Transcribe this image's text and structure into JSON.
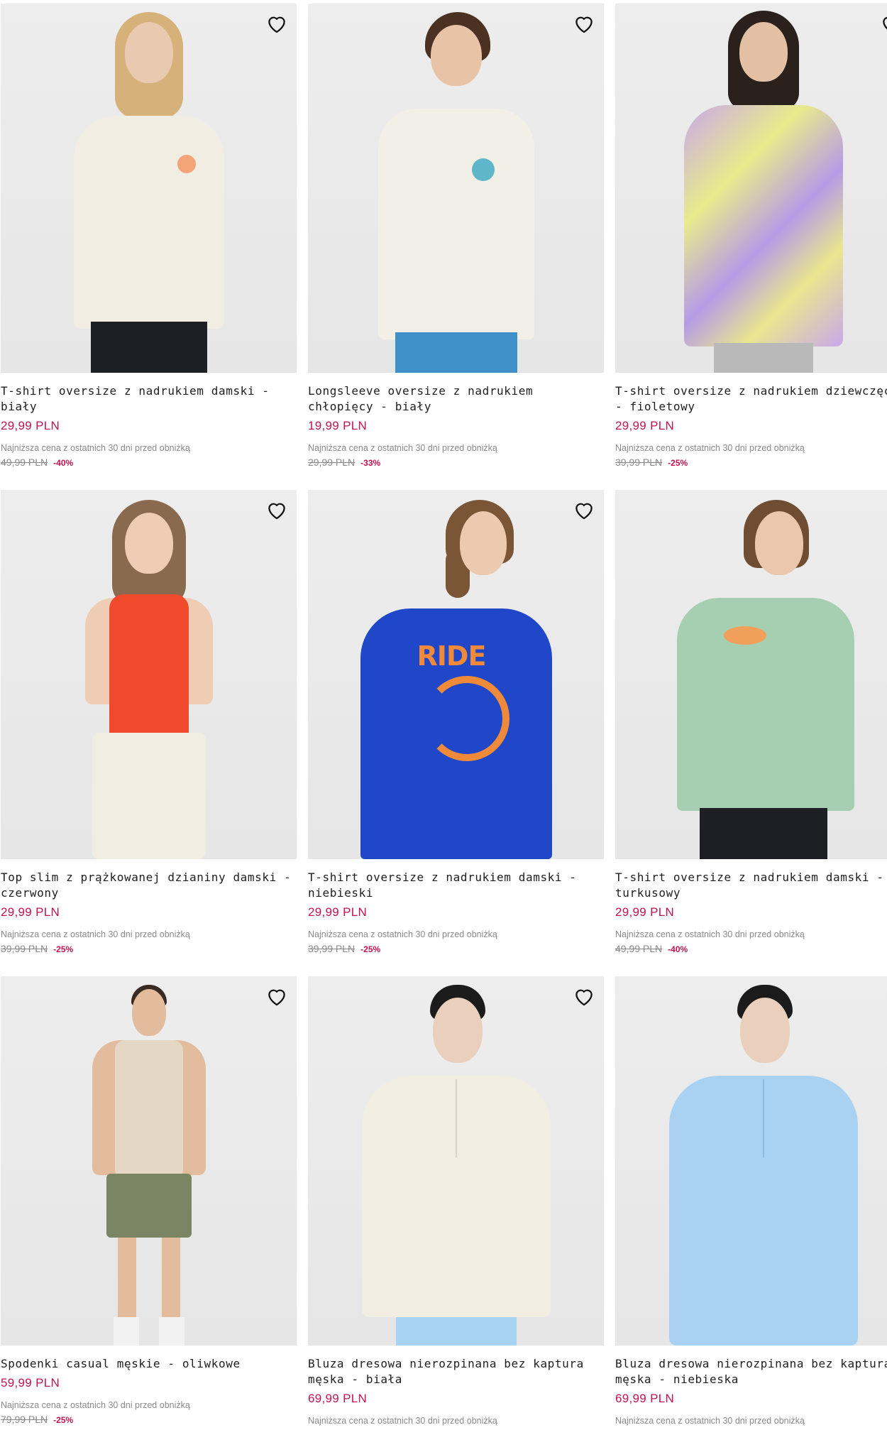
{
  "favorite_icon": "heart-outline-icon",
  "price_color": "#c4124f",
  "products": [
    {
      "name": "T-shirt oversize z nadrukiem damski - biały",
      "price": "29,99 PLN",
      "lowest_label": "Najniższa cena z ostatnich 30 dni przed obniżką",
      "old_price": "49,99 PLN",
      "discount": "-40%",
      "garment_color": "#f1ede3",
      "bottom_color": "#1d1f24",
      "skin": "#e9c9b0",
      "hair": "#d6b27a"
    },
    {
      "name": "Longsleeve oversize z nadrukiem chłopięcy - biały",
      "price": "19,99 PLN",
      "lowest_label": "Najniższa cena z ostatnich 30 dni przed obniżką",
      "old_price": "29,99 PLN",
      "discount": "-33%",
      "garment_color": "#f2efe6",
      "bottom_color": "#3f8fc9",
      "skin": "#e8c3a6",
      "hair": "#4a3122"
    },
    {
      "name": "T-shirt oversize z nadrukiem dziewczęcy - fioletowy",
      "price": "29,99 PLN",
      "lowest_label": "Najniższa cena z ostatnich 30 dni przed obniżką",
      "old_price": "39,99 PLN",
      "discount": "-25%",
      "garment_color": "#c9a8ea",
      "bottom_color": "#b9b9b9",
      "skin": "#e3c0a4",
      "hair": "#2b211c"
    },
    {
      "name": "Top slim z prążkowanej dzianiny damski - czerwony",
      "price": "29,99 PLN",
      "lowest_label": "Najniższa cena z ostatnich 30 dni przed obniżką",
      "old_price": "39,99 PLN",
      "discount": "-25%",
      "garment_color": "#ef4a2b",
      "bottom_color": "#f1ede3",
      "skin": "#efcdb5",
      "hair": "#8a6a4f"
    },
    {
      "name": "T-shirt oversize z nadrukiem damski - niebieski",
      "price": "29,99 PLN",
      "lowest_label": "Najniższa cena z ostatnich 30 dni przed obniżką",
      "old_price": "39,99 PLN",
      "discount": "-25%",
      "garment_color": "#1f47c8",
      "bottom_color": "#1f47c8",
      "skin": "#eccab0",
      "hair": "#7a5637"
    },
    {
      "name": "T-shirt oversize z nadrukiem damski - turkusowy",
      "price": "29,99 PLN",
      "lowest_label": "Najniższa cena z ostatnich 30 dni przed obniżką",
      "old_price": "49,99 PLN",
      "discount": "-40%",
      "garment_color": "#a6cfb1",
      "bottom_color": "#1d1f24",
      "skin": "#eac7ad",
      "hair": "#6e4d33"
    },
    {
      "name": "Spodenki casual męskie - oliwkowe",
      "price": "59,99 PLN",
      "lowest_label": "Najniższa cena z ostatnich 30 dni przed obniżką",
      "old_price": "79,99 PLN",
      "discount": "-25%",
      "garment_color": "#e4d7c4",
      "bottom_color": "#7b8563",
      "skin": "#e3bc9e",
      "hair": "#3a2b22"
    },
    {
      "name": "Bluza dresowa nierozpinana bez kaptura męska - biała",
      "price": "69,99 PLN",
      "lowest_label": "Najniższa cena z ostatnich 30 dni przed obniżką",
      "old_price": "",
      "discount": "",
      "garment_color": "#f1ede1",
      "bottom_color": "#a9d3f2",
      "skin": "#ead0bc",
      "hair": "#1b1b1b"
    },
    {
      "name": "Bluza dresowa nierozpinana bez kaptura męska - niebieska",
      "price": "69,99 PLN",
      "lowest_label": "Najniższa cena z ostatnich 30 dni przed obniżką",
      "old_price": "",
      "discount": "",
      "garment_color": "#a9d2f2",
      "bottom_color": "#a9d2f2",
      "skin": "#ead0bc",
      "hair": "#1b1b1b"
    }
  ]
}
